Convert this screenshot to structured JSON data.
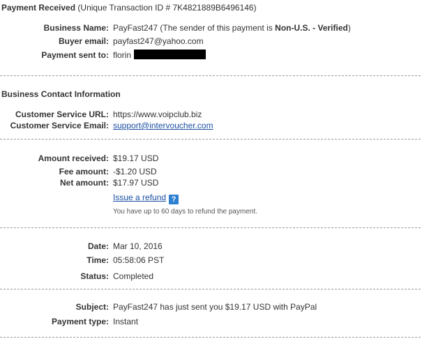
{
  "header": {
    "title": "Payment Received",
    "transaction_label": "(Unique Transaction ID # 7K4821889B6496146)"
  },
  "business": {
    "name_label": "Business Name:",
    "name_value": "PayFast247",
    "name_note_prefix": "(The sender of this payment is",
    "name_note_bold": "Non-U.S. - Verified",
    "name_note_suffix": ")",
    "buyer_email_label": "Buyer email:",
    "buyer_email_value": "payfast247@yahoo.com",
    "sent_to_label": "Payment sent to:",
    "sent_to_value": "florin"
  },
  "contact": {
    "title": "Business Contact Information",
    "url_label": "Customer Service URL:",
    "url_value": "https://www.voipclub.biz",
    "email_label": "Customer Service Email:",
    "email_value": "support@intervoucher.com"
  },
  "amounts": {
    "received_label": "Amount received:",
    "received_value": "$19.17 USD",
    "fee_label": "Fee amount:",
    "fee_value": "-$1.20 USD",
    "net_label": "Net amount:",
    "net_value": "$17.97 USD",
    "refund_link": "Issue a refund",
    "help_icon": "?",
    "refund_note": "You have up to 60 days to refund the payment."
  },
  "status": {
    "date_label": "Date:",
    "date_value": "Mar 10, 2016",
    "time_label": "Time:",
    "time_value": "05:58:06 PST",
    "status_label": "Status:",
    "status_value": "Completed"
  },
  "details": {
    "subject_label": "Subject:",
    "subject_value": "PayFast247 has just sent you $19.17 USD with PayPal",
    "type_label": "Payment type:",
    "type_value": "Instant"
  },
  "colors": {
    "link": "#1a4fa3",
    "help_icon_bg": "#2d7fd1",
    "redaction": "#000000",
    "separator": "#9a9a9a"
  }
}
